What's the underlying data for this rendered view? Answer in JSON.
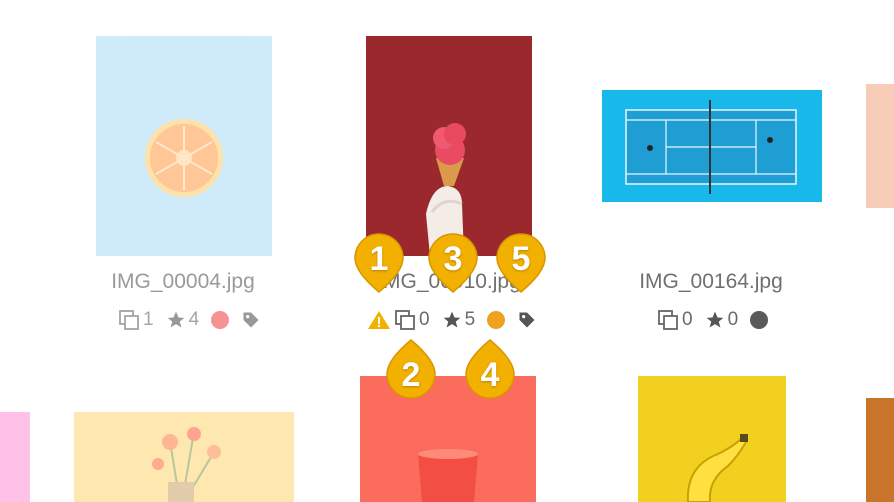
{
  "gallery": {
    "items": [
      {
        "filename": "IMG_00004.jpg",
        "versions": "1",
        "rating": "4",
        "color_label": "#f04c4c"
      },
      {
        "filename": "IMG_00010.jpg",
        "versions": "0",
        "rating": "5",
        "color_label": "#f2a020"
      },
      {
        "filename": "IMG_00164.jpg",
        "versions": "0",
        "rating": "0",
        "color_label": "#5a5a5a"
      }
    ]
  },
  "callouts": [
    "1",
    "2",
    "3",
    "4",
    "5"
  ],
  "colors": {
    "callout": "#f2b000",
    "warning": "#f2b000"
  }
}
